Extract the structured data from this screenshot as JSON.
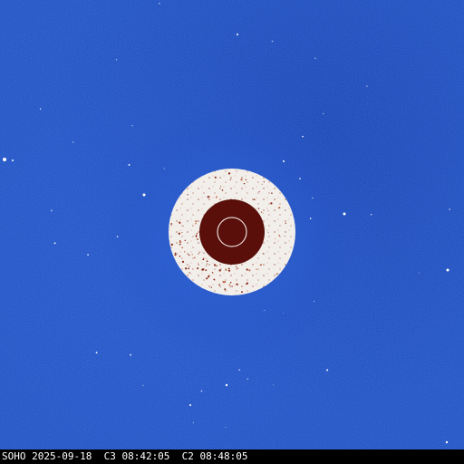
{
  "image": {
    "subject": "coronagraph",
    "colors": {
      "background_blue": "#1f4fbf",
      "occulter_ring": "#f2eeea",
      "occulter_disk": "#5a0f0a",
      "sun_outline": "#ffffff",
      "caption_bar": "#000000",
      "caption_text": "#ffffff"
    }
  },
  "caption": {
    "text": "SOHO 2025-09-18  C3 08:42:05  C2 08:48:05"
  }
}
